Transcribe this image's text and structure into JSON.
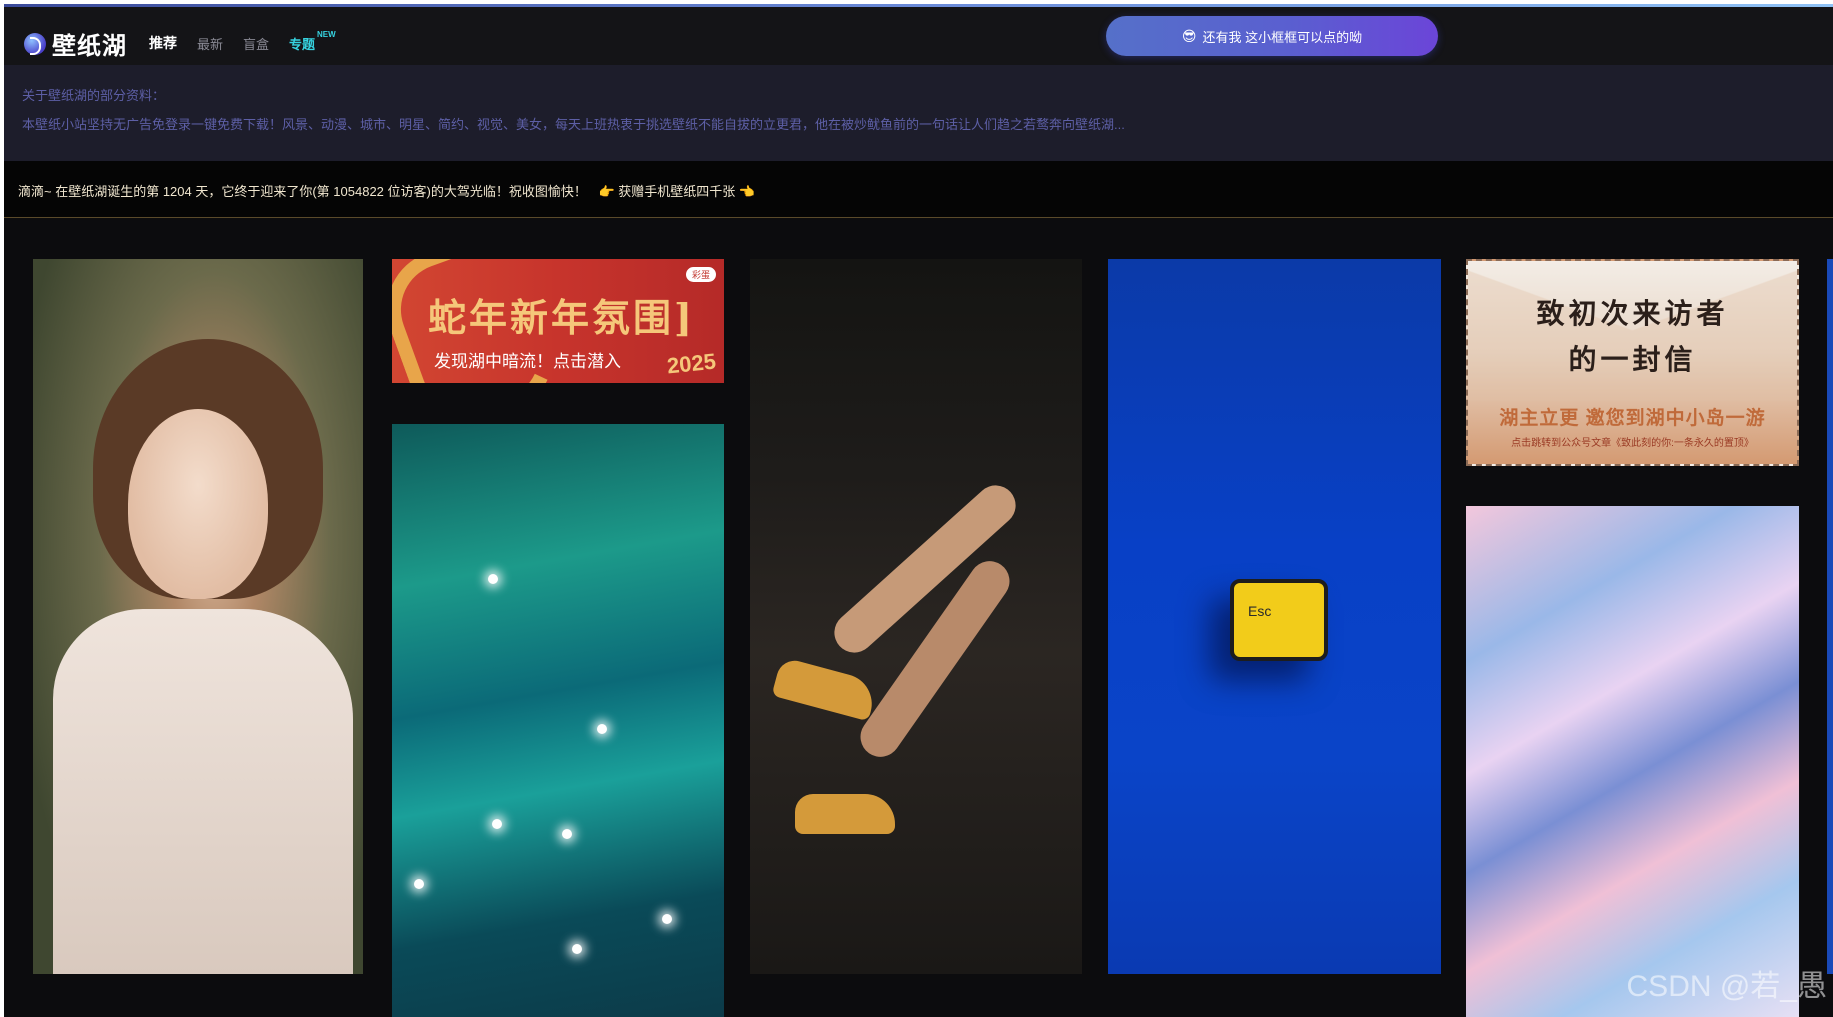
{
  "header": {
    "logo_text": "壁纸湖",
    "nav": [
      {
        "label": "推荐"
      },
      {
        "label": "最新"
      },
      {
        "label": "盲盒"
      },
      {
        "label": "专题",
        "badge": "NEW"
      }
    ],
    "notice": {
      "emoji": "😎",
      "text": "还有我 这小框框可以点的呦"
    }
  },
  "info": {
    "title": "关于壁纸湖的部分资料：",
    "text": "本壁纸小站坚持无广告免登录一键免费下载！风景、动漫、城市、明星、简约、视觉、美女，每天上班热衷于挑选壁纸不能自拔的立更君，他在被炒鱿鱼前的一句话让人们趋之若鹜奔向壁纸湖..."
  },
  "announcement": {
    "text": "滴滴~ 在壁纸湖诞生的第 1204 天，它终于迎来了你(第 1054822 位访客)的大驾光临！祝收图愉快！",
    "link": "👉 获赠手机壁纸四千张 👈"
  },
  "cards": {
    "banner": {
      "title": "蛇年新年氛围]",
      "subtitle": "发现湖中暗流！点击潜入",
      "year": "2025",
      "tag": "彩蛋"
    },
    "esc_label": "Esc",
    "letter": {
      "title_line1": "致初次来访者",
      "title_line2": "的一封信",
      "subtitle": "湖主立更 邀您到湖中小岛一游",
      "note": "点击跳转到公众号文章《致此刻的你:一条永久的置顶》"
    }
  },
  "watermark": "CSDN @若_愚",
  "colors": {
    "background": "#0c0c0e",
    "header": "#141417",
    "info_panel": "#1d1d2b",
    "accent_cyan": "#36d3e0",
    "pill_start": "#5570c9",
    "pill_end": "#6b45d8"
  }
}
